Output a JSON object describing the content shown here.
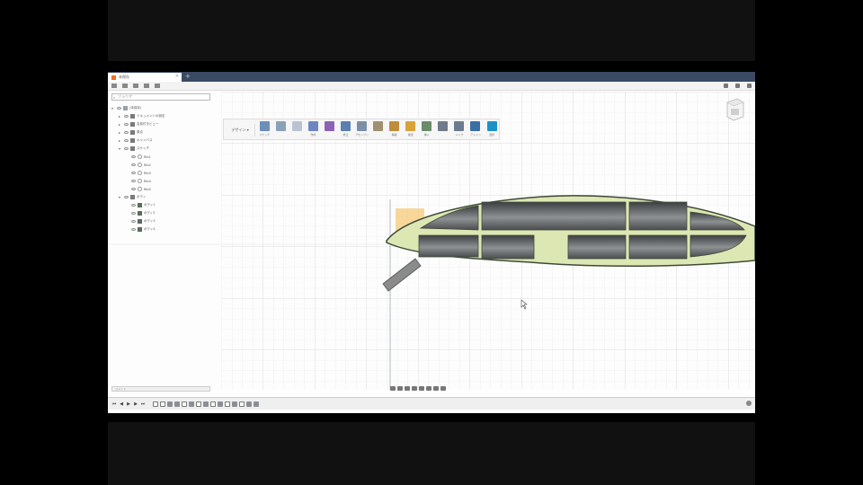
{
  "app": {
    "tab": {
      "label": "未保存",
      "close_glyph": "×"
    },
    "search": {
      "placeholder": "ブラウザ"
    },
    "workspace": {
      "label": "デザイン ▾"
    }
  },
  "toolbar": {
    "tools": [
      {
        "label": "スケッチ",
        "color": "#6b8fb8"
      },
      {
        "label": "",
        "color": "#8aa1b8"
      },
      {
        "label": "",
        "color": "#b8c4d1"
      },
      {
        "label": "作成",
        "color": "#6d86c1"
      },
      {
        "label": "",
        "color": "#8a63b5"
      },
      {
        "label": "修正",
        "color": "#5a7fb0"
      },
      {
        "label": "アセンブリ",
        "color": "#7b8fa8"
      },
      {
        "label": "",
        "color": "#a08f70"
      },
      {
        "label": "構築",
        "color": "#c08b3a"
      },
      {
        "label": "検査",
        "color": "#d9a23a"
      },
      {
        "label": "挿入",
        "color": "#6a8c6a"
      },
      {
        "label": "",
        "color": "#707a8a"
      },
      {
        "label": "メイク",
        "color": "#6a7a90"
      },
      {
        "label": "アドイン",
        "color": "#3a6ea5"
      },
      {
        "label": "選択",
        "color": "#1e90c8"
      }
    ]
  },
  "browser": {
    "items": [
      {
        "label": "(未保存)",
        "arrow": "▾",
        "icon": "comp",
        "indent": 0
      },
      {
        "label": "ドキュメントの設定",
        "arrow": "▸",
        "icon": "box",
        "indent": 1
      },
      {
        "label": "名前付きビュー",
        "arrow": "▸",
        "icon": "box",
        "indent": 1
      },
      {
        "label": "原点",
        "arrow": "▸",
        "icon": "box",
        "indent": 1
      },
      {
        "label": "キャンバス",
        "arrow": "▸",
        "icon": "box",
        "indent": 1
      },
      {
        "label": "スケッチ",
        "arrow": "▾",
        "icon": "box",
        "indent": 1
      },
      {
        "label": "Rib1",
        "arrow": "",
        "icon": "sk",
        "indent": 2
      },
      {
        "label": "Rib2",
        "arrow": "",
        "icon": "sk",
        "indent": 2
      },
      {
        "label": "Rib3",
        "arrow": "",
        "icon": "sk",
        "indent": 2
      },
      {
        "label": "Rib4",
        "arrow": "",
        "icon": "sk",
        "indent": 2
      },
      {
        "label": "Rib5",
        "arrow": "",
        "icon": "sk",
        "indent": 2
      },
      {
        "label": "ボディ",
        "arrow": "▾",
        "icon": "box",
        "indent": 1
      },
      {
        "label": "ボディ1",
        "arrow": "",
        "icon": "body",
        "indent": 2
      },
      {
        "label": "ボディ2",
        "arrow": "",
        "icon": "body",
        "indent": 2
      },
      {
        "label": "ボディ3",
        "arrow": "",
        "icon": "body",
        "indent": 2
      },
      {
        "label": "ボディ4",
        "arrow": "",
        "icon": "body",
        "indent": 2
      }
    ]
  },
  "comments": {
    "label": "コメント"
  },
  "timeline": {
    "buttons": [
      "⏮",
      "◀",
      "▶",
      "▶",
      "⏭"
    ],
    "features": [
      "sk",
      "sk",
      "f",
      "f",
      "sk",
      "f",
      "sk",
      "f",
      "sk",
      "f",
      "sk",
      "f",
      "sk",
      "f",
      "f"
    ]
  },
  "colors": {
    "titlebar": "#3a4a63",
    "rib_fill": "#dde7b4",
    "rib_stroke": "#3f4a38",
    "pocket": "#55585a",
    "highlight": "#f5c97a"
  }
}
